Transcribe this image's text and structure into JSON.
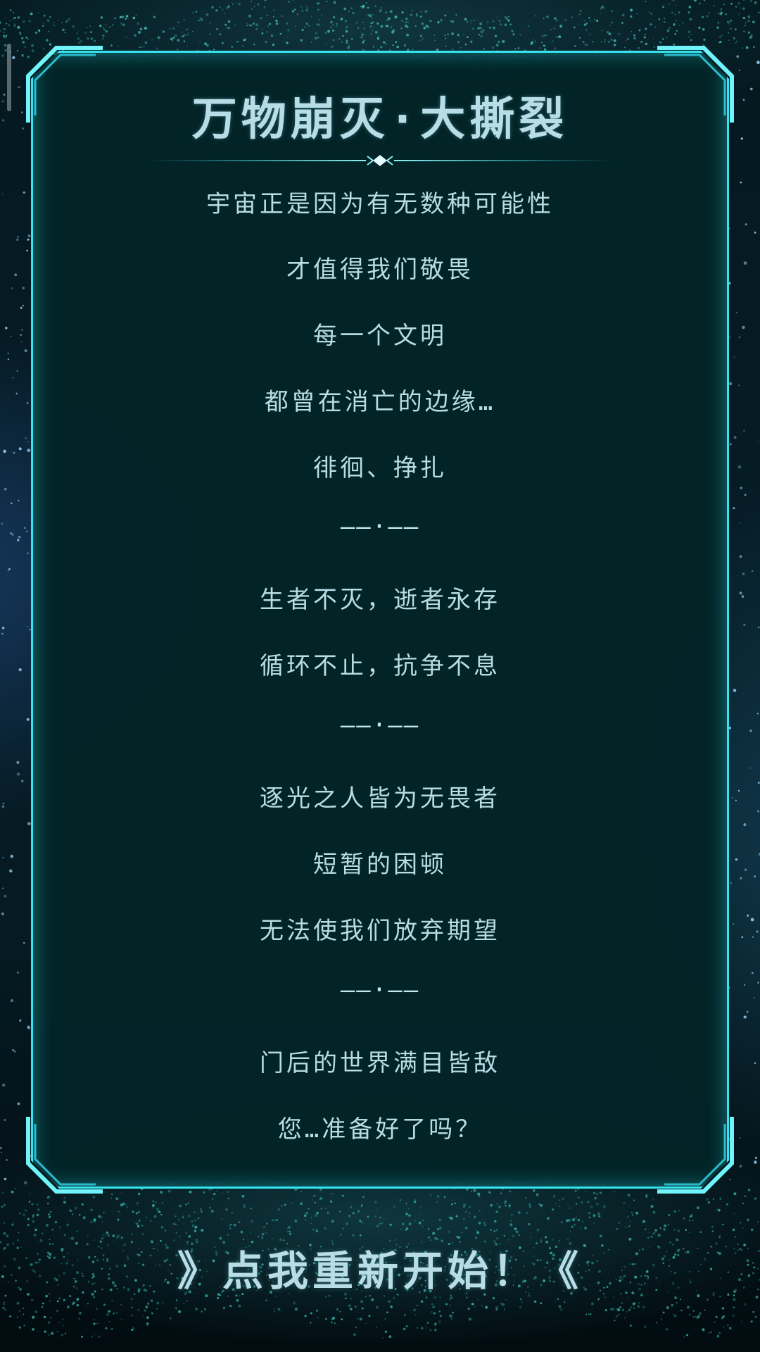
{
  "title": "万物崩灭·大撕裂",
  "lines": [
    "宇宙正是因为有无数种可能性",
    "才值得我们敬畏",
    "每一个文明",
    "都曾在消亡的边缘…",
    "徘徊、挣扎",
    "——·——",
    "生者不灭，逝者永存",
    "循环不止，抗争不息",
    "——·——",
    "逐光之人皆为无畏者",
    "短暂的困顿",
    "无法使我们放弃期望",
    "——·——",
    "门后的世界满目皆敌",
    "您…准备好了吗？"
  ],
  "restart_label": "》点我重新开始！《",
  "colors": {
    "frame": "#36e4ef",
    "panel": "#022428",
    "text": "#b9dbe3"
  }
}
